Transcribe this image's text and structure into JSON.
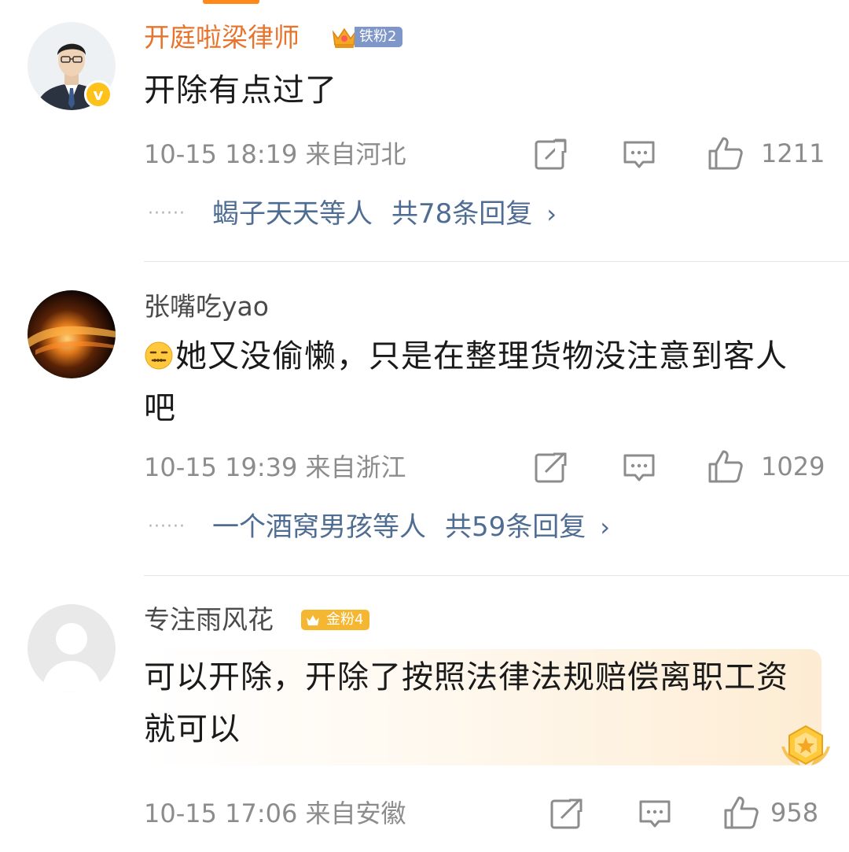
{
  "comments": [
    {
      "username": "开庭啦梁律师",
      "fan_badge": "铁粉2",
      "content": "开除有点过了",
      "meta": "10-15 18:19 来自河北",
      "likes": "1211",
      "reply_dots": "······",
      "reply_who": "蝎子天天等人",
      "reply_count": "共78条回复",
      "reply_chevron": "›"
    },
    {
      "username": "张嘴吃yao",
      "content": "她又没偷懒，只是在整理货物没注意到客人吧",
      "meta": "10-15 19:39 来自浙江",
      "likes": "1029",
      "reply_dots": "······",
      "reply_who": "一个酒窝男孩等人",
      "reply_count": "共59条回复",
      "reply_chevron": "›"
    },
    {
      "username": "专注雨风花",
      "fan_badge": "金粉4",
      "content": "可以开除，开除了按照法律法规赔偿离职工资就可以",
      "meta": "10-15 17:06 来自安徽",
      "likes": "958"
    }
  ],
  "icons": {
    "verified": "verified-v-icon",
    "forward": "share-icon",
    "comment": "comment-icon",
    "like": "thumbs-up-icon",
    "emoji": "zipper-mouth-emoji-icon"
  },
  "colors": {
    "username_highlight": "#e8742c",
    "reply_link": "#4f6d92",
    "meta": "#8c8c8c",
    "verified": "#ffc21a",
    "iron_fan": "#7e96c8",
    "gold_fan": "#f5b731"
  }
}
